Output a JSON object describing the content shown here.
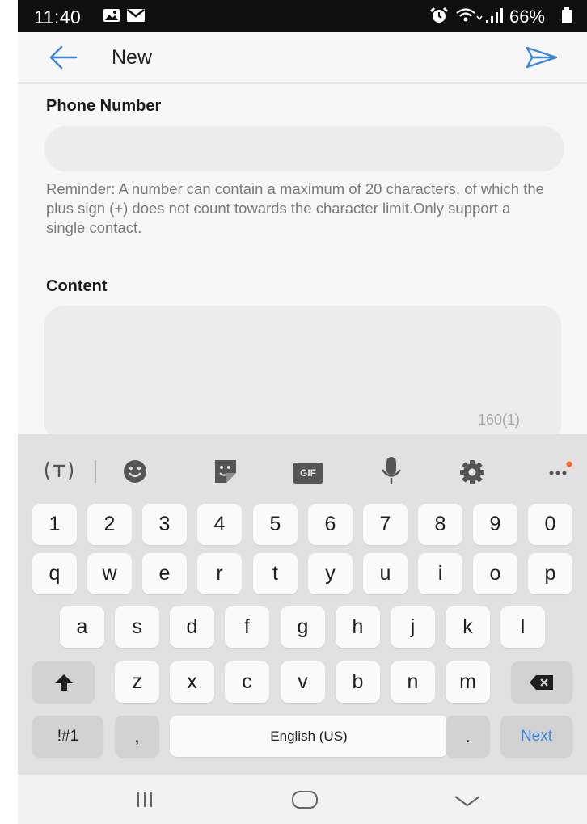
{
  "status_bar": {
    "time": "11:40",
    "battery": "66%"
  },
  "header": {
    "title": "New"
  },
  "form": {
    "phone_label": "Phone Number",
    "phone_value": "",
    "reminder": "Reminder: A number can contain a maximum of 20 characters, of which the plus sign (+) does not count towards the character limit.Only support a single contact.",
    "content_label": "Content",
    "content_value": "",
    "counter": "160(1)"
  },
  "keyboard": {
    "toolbar_icons": [
      "text-mode-icon",
      "emoji-icon",
      "sticker-icon",
      "gif-icon",
      "microphone-icon",
      "gear-icon",
      "more-icon"
    ],
    "gif_label": "GIF",
    "rows": [
      [
        "1",
        "2",
        "3",
        "4",
        "5",
        "6",
        "7",
        "8",
        "9",
        "0"
      ],
      [
        "q",
        "w",
        "e",
        "r",
        "t",
        "y",
        "u",
        "i",
        "o",
        "p"
      ],
      [
        "a",
        "s",
        "d",
        "f",
        "g",
        "h",
        "j",
        "k",
        "l"
      ],
      [
        "z",
        "x",
        "c",
        "v",
        "b",
        "n",
        "m"
      ]
    ],
    "symbols_label": "!#1",
    "comma_label": ",",
    "space_label": "English (US)",
    "period_label": ".",
    "next_label": "Next"
  },
  "colors": {
    "accent": "#3e86d9",
    "notification_dot": "#f26522"
  }
}
